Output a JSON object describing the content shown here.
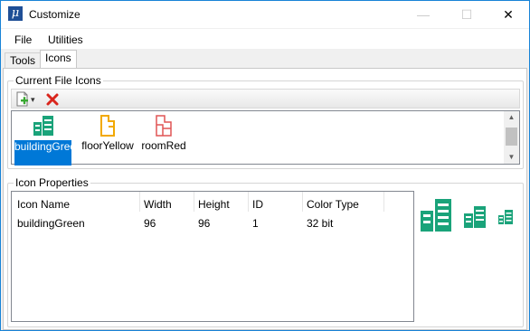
{
  "window": {
    "title": "Customize",
    "app_icon_glyph": "μ",
    "minimize_glyph": "—",
    "maximize_glyph": "☐",
    "close_glyph": "✕"
  },
  "menu": {
    "items": [
      "File",
      "Utilities"
    ]
  },
  "tabs": [
    {
      "label": "Tools",
      "active": false
    },
    {
      "label": "Icons",
      "active": true
    }
  ],
  "current_file_icons": {
    "group_title": "Current File Icons",
    "toolbar": {
      "new_icon": "new-icon",
      "dropdown_arrow": "▾",
      "delete_icon": "delete-icon"
    },
    "icons": [
      {
        "label": "buildingGreen",
        "icon": "building-icon",
        "color": "#1aa37a",
        "selected": true
      },
      {
        "label": "floorYellow",
        "icon": "floor-icon",
        "color": "#f2a900",
        "selected": false
      },
      {
        "label": "roomRed",
        "icon": "room-icon",
        "color": "#e05555",
        "selected": false
      }
    ],
    "scroll_up": "▲",
    "scroll_down": "▼"
  },
  "icon_properties": {
    "group_title": "Icon Properties",
    "columns": [
      "Icon Name",
      "Width",
      "Height",
      "ID",
      "Color Type"
    ],
    "rows": [
      [
        "buildingGreen",
        "96",
        "96",
        "1",
        "32 bit"
      ]
    ],
    "preview_color": "#1aa37a"
  }
}
